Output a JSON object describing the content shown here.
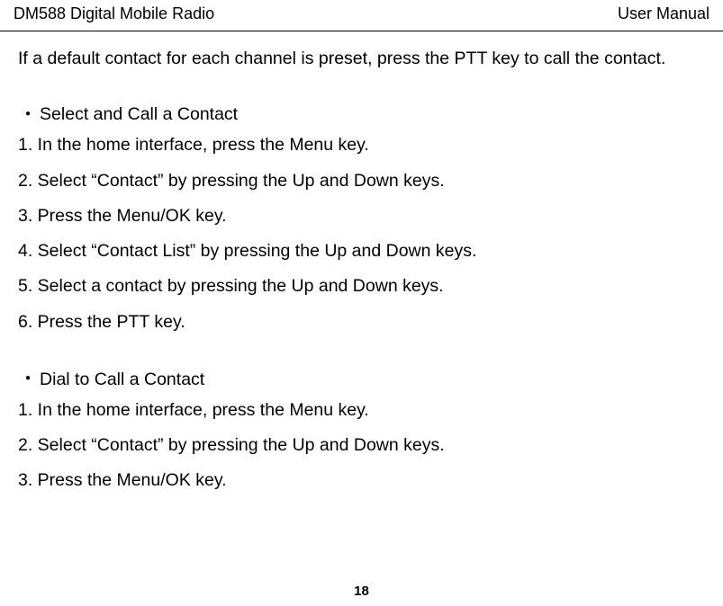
{
  "header": {
    "left": "DM588 Digital Mobile Radio",
    "right": "User Manual"
  },
  "intro": "If a default contact for each channel is preset, press the PTT key to call the contact.",
  "section1": {
    "title": "Select and Call a Contact",
    "steps": [
      "1. In the home interface, press the Menu key.",
      "2. Select “Contact” by pressing the Up and Down keys.",
      "3. Press the Menu/OK key.",
      "4. Select “Contact List” by pressing the Up and Down keys.",
      "5. Select a contact by pressing the Up and Down keys.",
      "6. Press the PTT key."
    ]
  },
  "section2": {
    "title": "Dial to Call a Contact",
    "steps": [
      "1. In the home interface, press the Menu key.",
      "2. Select “Contact” by pressing the Up and Down keys.",
      "3. Press the Menu/OK key."
    ]
  },
  "pageNumber": "18"
}
